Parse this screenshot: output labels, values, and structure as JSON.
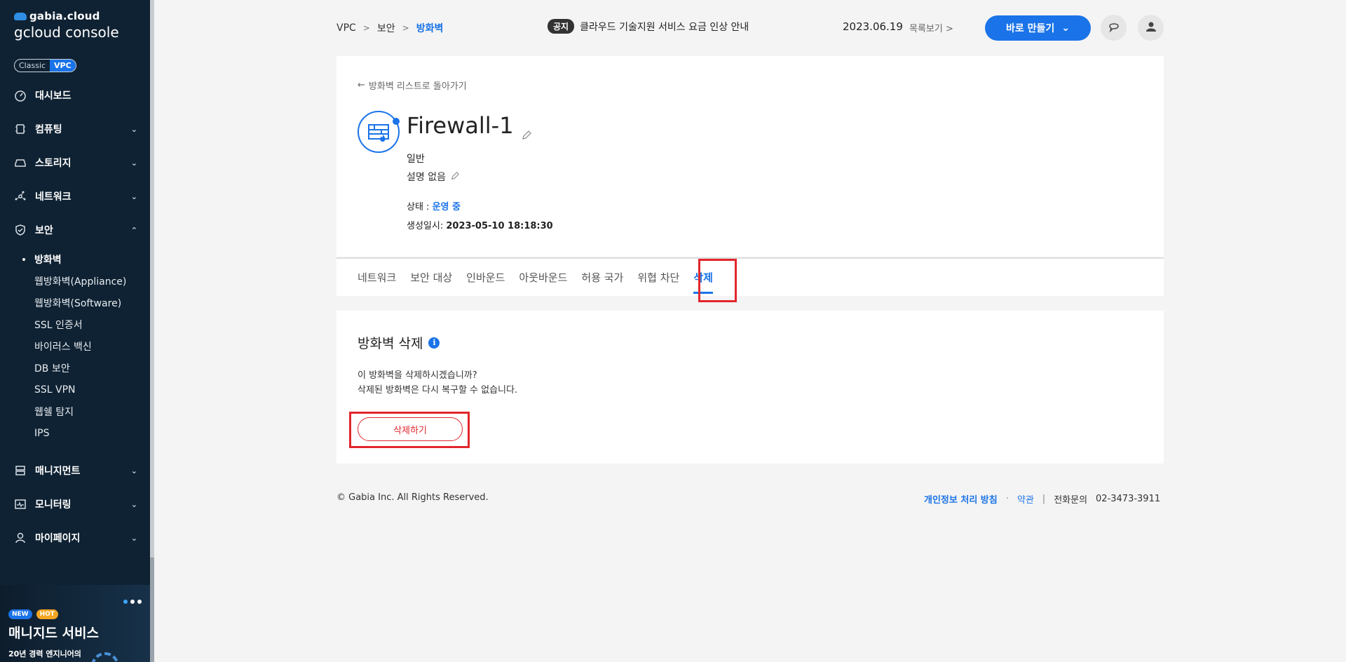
{
  "sidebar": {
    "brand_top": "gabia.cloud",
    "brand_main": "gcloud console",
    "modes": [
      "Classic",
      "VPC"
    ],
    "active_mode": "VPC",
    "items": [
      {
        "label": "대시보드",
        "icon": "dashboard-icon"
      },
      {
        "label": "컴퓨팅",
        "icon": "chip-icon"
      },
      {
        "label": "스토리지",
        "icon": "storage-icon"
      },
      {
        "label": "네트워크",
        "icon": "network-icon"
      },
      {
        "label": "보안",
        "icon": "shield-icon"
      },
      {
        "label": "매니지먼트",
        "icon": "server-icon"
      },
      {
        "label": "모니터링",
        "icon": "monitor-icon"
      },
      {
        "label": "마이페이지",
        "icon": "user-icon"
      }
    ],
    "security_sub": [
      "방화벽",
      "웹방화벽(Appliance)",
      "웹방화벽(Software)",
      "SSL 인증서",
      "바이러스 백신",
      "DB 보안",
      "SSL VPN",
      "웹쉘 탐지",
      "IPS"
    ],
    "promo": {
      "badge_new": "NEW",
      "badge_hot": "HOT",
      "title": "매니지드 서비스",
      "subtitle": "20년 경력 엔지니어의"
    }
  },
  "header": {
    "breadcrumb": [
      "VPC",
      "보안",
      "방화벽"
    ],
    "notice_tag": "공지",
    "notice_text": "클라우드 기술지원 서비스 요금 인상 안내",
    "notice_date": "2023.06.19",
    "notice_more": "목록보기",
    "create_label": "바로 만들기"
  },
  "firewall": {
    "back_label": "방화벽 리스트로 돌아가기",
    "name": "Firewall-1",
    "type": "일반",
    "description": "설명 없음",
    "status_label": "상태 : ",
    "status_value": "운영 중",
    "created_label": "생성일시: ",
    "created_value": "2023-05-10 18:18:30"
  },
  "tabs": [
    "네트워크",
    "보안 대상",
    "인바운드",
    "아웃바운드",
    "허용 국가",
    "위협 차단",
    "삭제"
  ],
  "delete_section": {
    "title": "방화벽 삭제",
    "line1": "이 방화벽을 삭제하시겠습니까?",
    "line2": "삭제된 방화벽은 다시 복구할 수 없습니다.",
    "button": "삭제하기"
  },
  "footer": {
    "copyright": "© Gabia Inc. All Rights Reserved.",
    "privacy": "개인정보 처리 방침",
    "terms": "약관",
    "phone_label": "전화문의",
    "phone": "02-3473-3911"
  },
  "colors": {
    "accent": "#1a73e8",
    "sidebar_bg": "#0f2233",
    "danger": "#e2262d"
  }
}
